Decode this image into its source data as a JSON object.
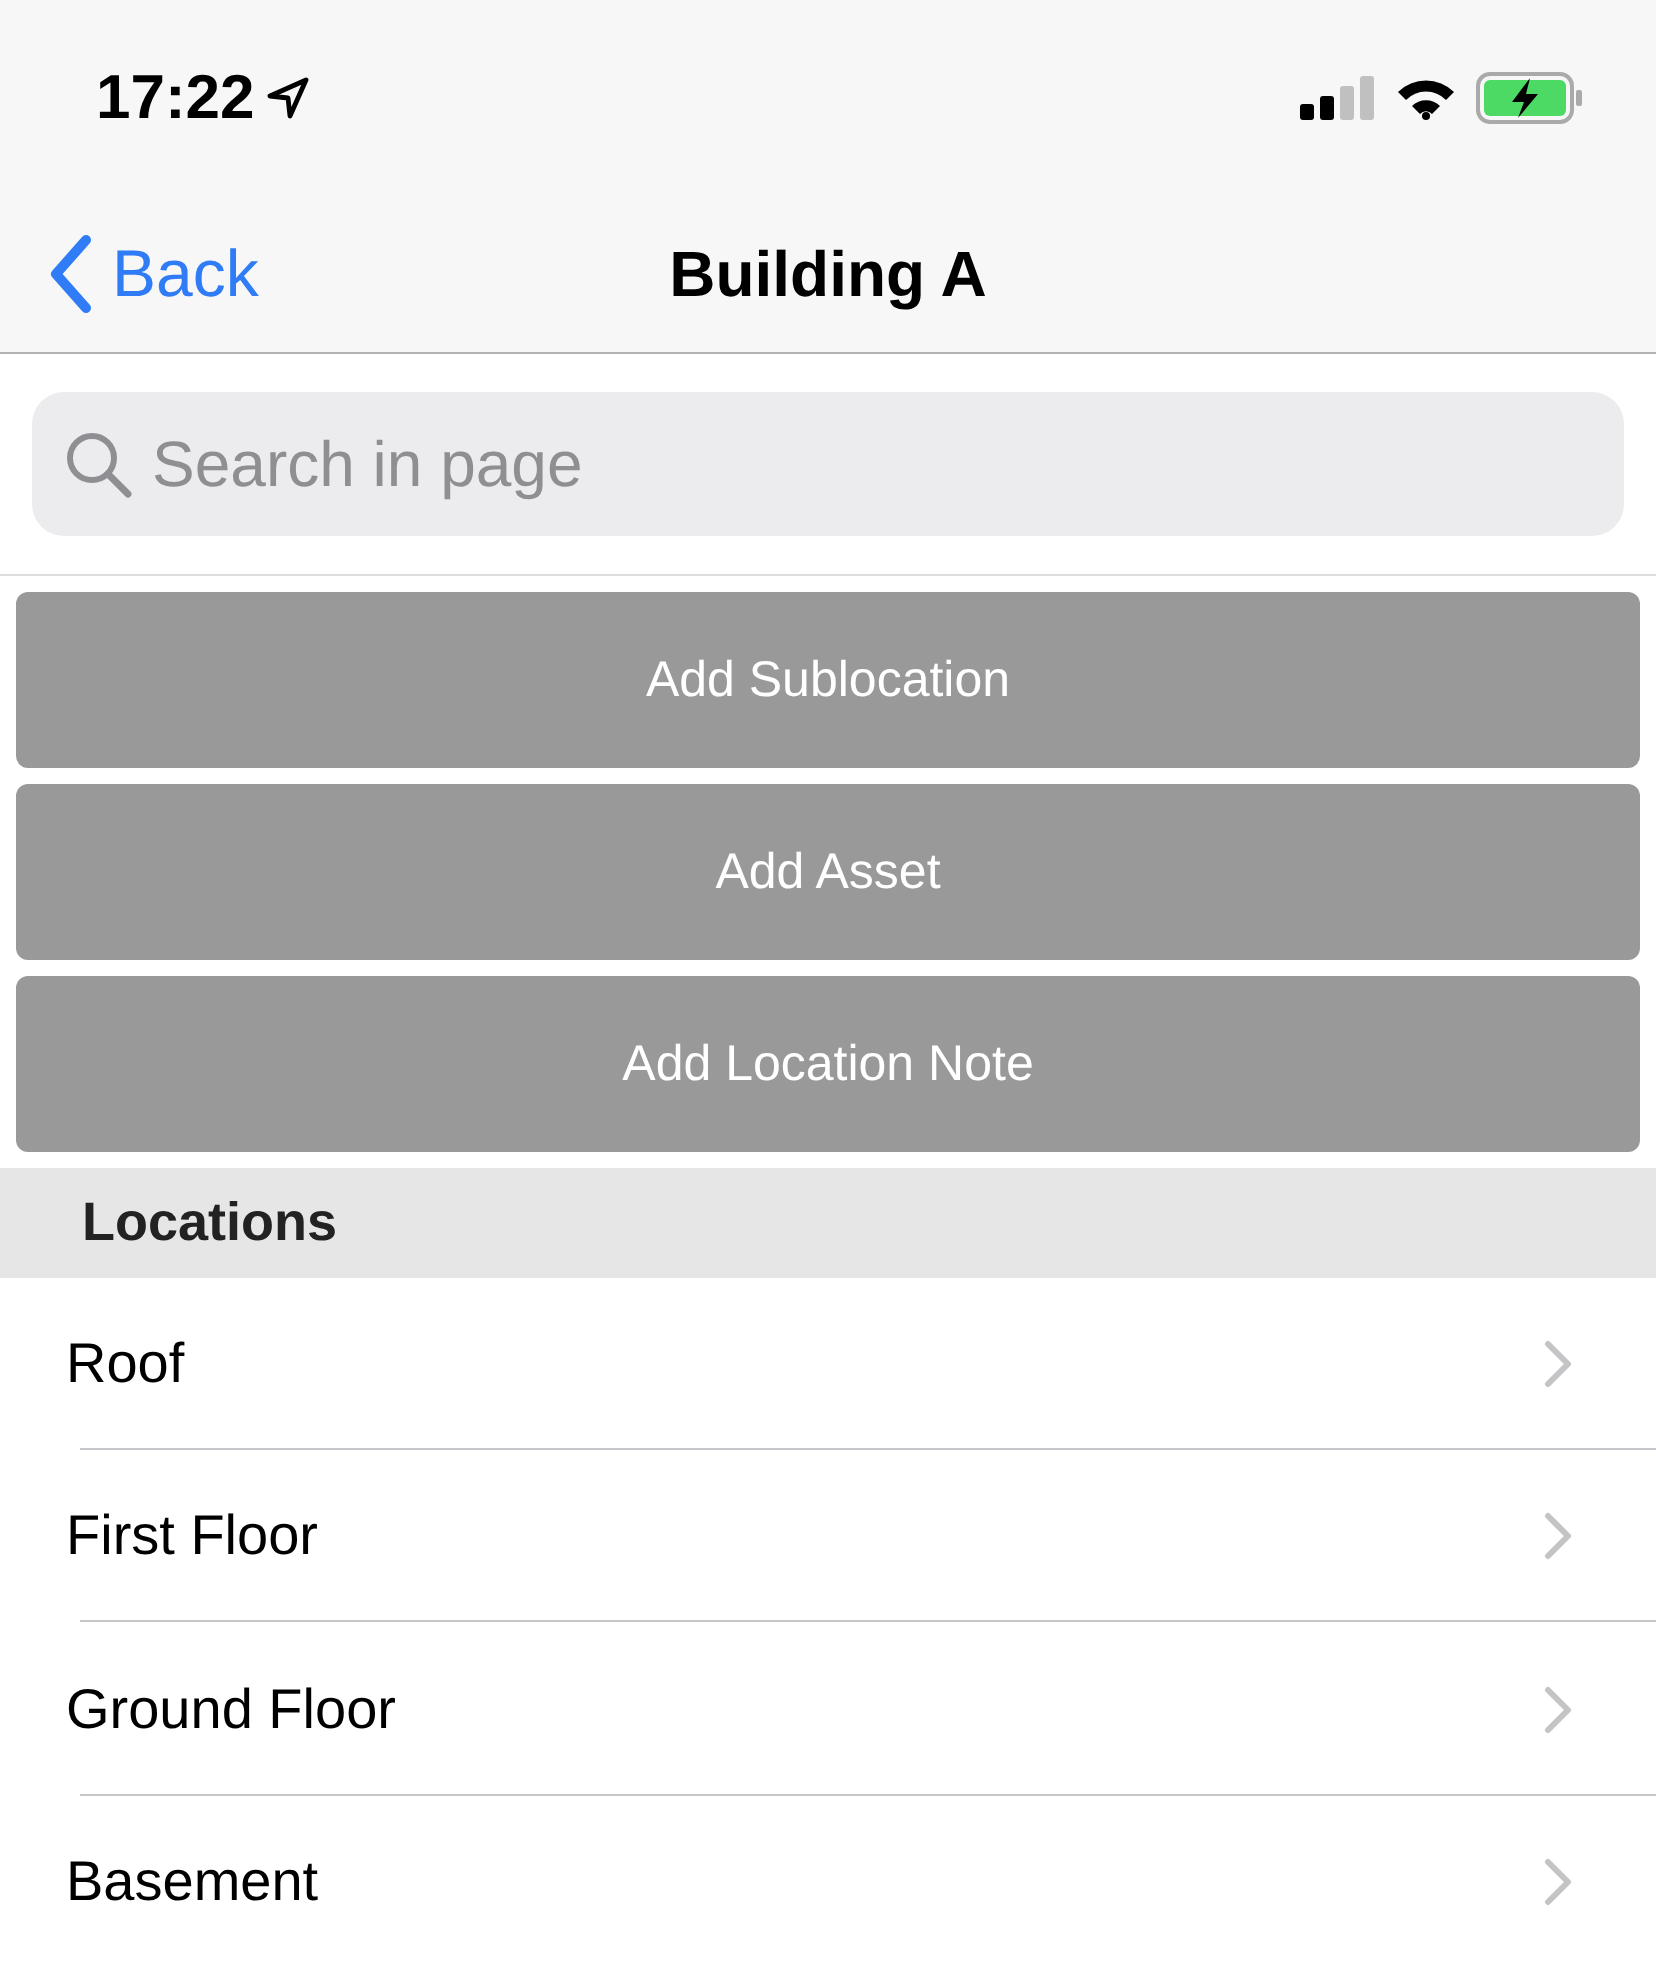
{
  "status_bar": {
    "time": "17:22"
  },
  "nav": {
    "back": "Back",
    "title": "Building A"
  },
  "search": {
    "placeholder": "Search in page"
  },
  "buttons": [
    "Add Sublocation",
    "Add Asset",
    "Add Location Note"
  ],
  "section": {
    "title": "Locations"
  },
  "rows": [
    {
      "label": "Roof"
    },
    {
      "label": "First Floor"
    },
    {
      "label": "Ground Floor"
    },
    {
      "label": "Basement"
    }
  ]
}
